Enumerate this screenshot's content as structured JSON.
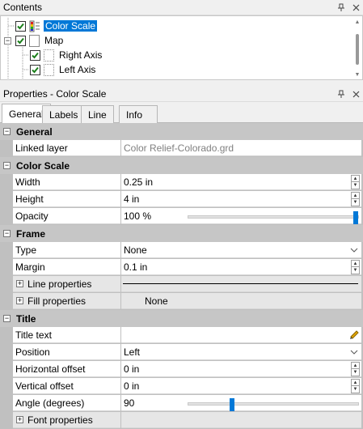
{
  "contents_pane": {
    "title": "Contents",
    "pin_icon": "pin-icon",
    "close_icon": "close-icon",
    "items": [
      {
        "label": "Color Scale",
        "checked": true,
        "selected": true,
        "icon": "color-scale-icon"
      },
      {
        "label": "Map",
        "checked": true,
        "selected": false,
        "icon": "map-icon",
        "expanded": true
      },
      {
        "label": "Right Axis",
        "checked": true,
        "selected": false,
        "icon": "axis-icon"
      },
      {
        "label": "Left Axis",
        "checked": true,
        "selected": false,
        "icon": "axis-icon"
      }
    ]
  },
  "properties_pane": {
    "title": "Properties - Color Scale",
    "tabs": [
      "General",
      "Labels",
      "Line",
      "Info"
    ],
    "active_tab": "General"
  },
  "grid": {
    "general": {
      "title": "General",
      "linked_layer_label": "Linked layer",
      "linked_layer_value": "Color Relief-Colorado.grd"
    },
    "color_scale": {
      "title": "Color Scale",
      "width_label": "Width",
      "width_value": "0.25 in",
      "height_label": "Height",
      "height_value": "4 in",
      "opacity_label": "Opacity",
      "opacity_value": "100 %",
      "opacity_level": 1.0
    },
    "frame": {
      "title": "Frame",
      "type_label": "Type",
      "type_value": "None",
      "margin_label": "Margin",
      "margin_value": "0.1 in",
      "line_props_label": "Line properties",
      "fill_props_label": "Fill properties",
      "fill_props_value": "None"
    },
    "title_section": {
      "title": "Title",
      "title_text_label": "Title text",
      "title_text_value": "",
      "position_label": "Position",
      "position_value": "Left",
      "h_offset_label": "Horizontal offset",
      "h_offset_value": "0 in",
      "v_offset_label": "Vertical offset",
      "v_offset_value": "0 in",
      "angle_label": "Angle (degrees)",
      "angle_value": "90",
      "angle_level": 0.25,
      "font_props_label": "Font properties"
    }
  },
  "colors": {
    "accent": "#0078d7",
    "category_bg": "#c6c6c6",
    "pencil": "#e5a800"
  }
}
